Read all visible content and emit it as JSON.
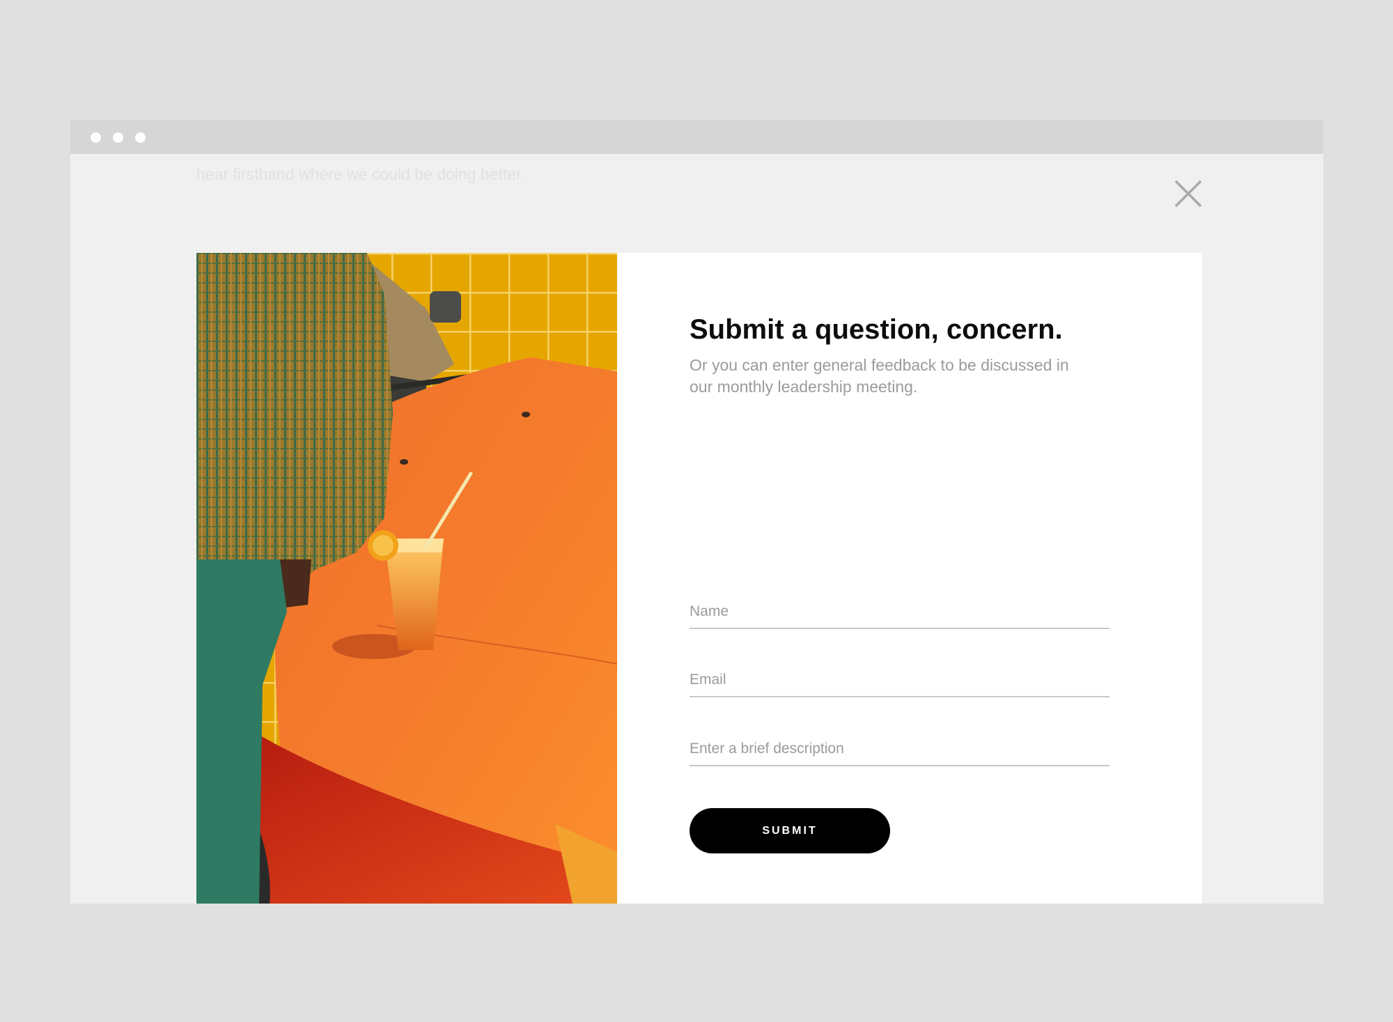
{
  "window": {
    "controls": [
      "dot",
      "dot",
      "dot"
    ]
  },
  "background": {
    "partial_text": "hear firsthand where we could be doing better."
  },
  "modal": {
    "close_icon": "close-icon",
    "title": "Submit a question, concern.",
    "subtitle": "Or you can enter general feedback to be discussed in our monthly leadership meeting.",
    "fields": {
      "name_placeholder": "Name",
      "email_placeholder": "Email",
      "description_placeholder": "Enter a brief description"
    },
    "submit_label": "SUBMIT"
  },
  "colors": {
    "page_background": "#e0e0e0",
    "window_background": "#f0f0f0",
    "titlebar": "#d6d6d6",
    "button": "#000000",
    "muted_text": "#9b9b9b",
    "title_text": "#0d0d0d"
  }
}
